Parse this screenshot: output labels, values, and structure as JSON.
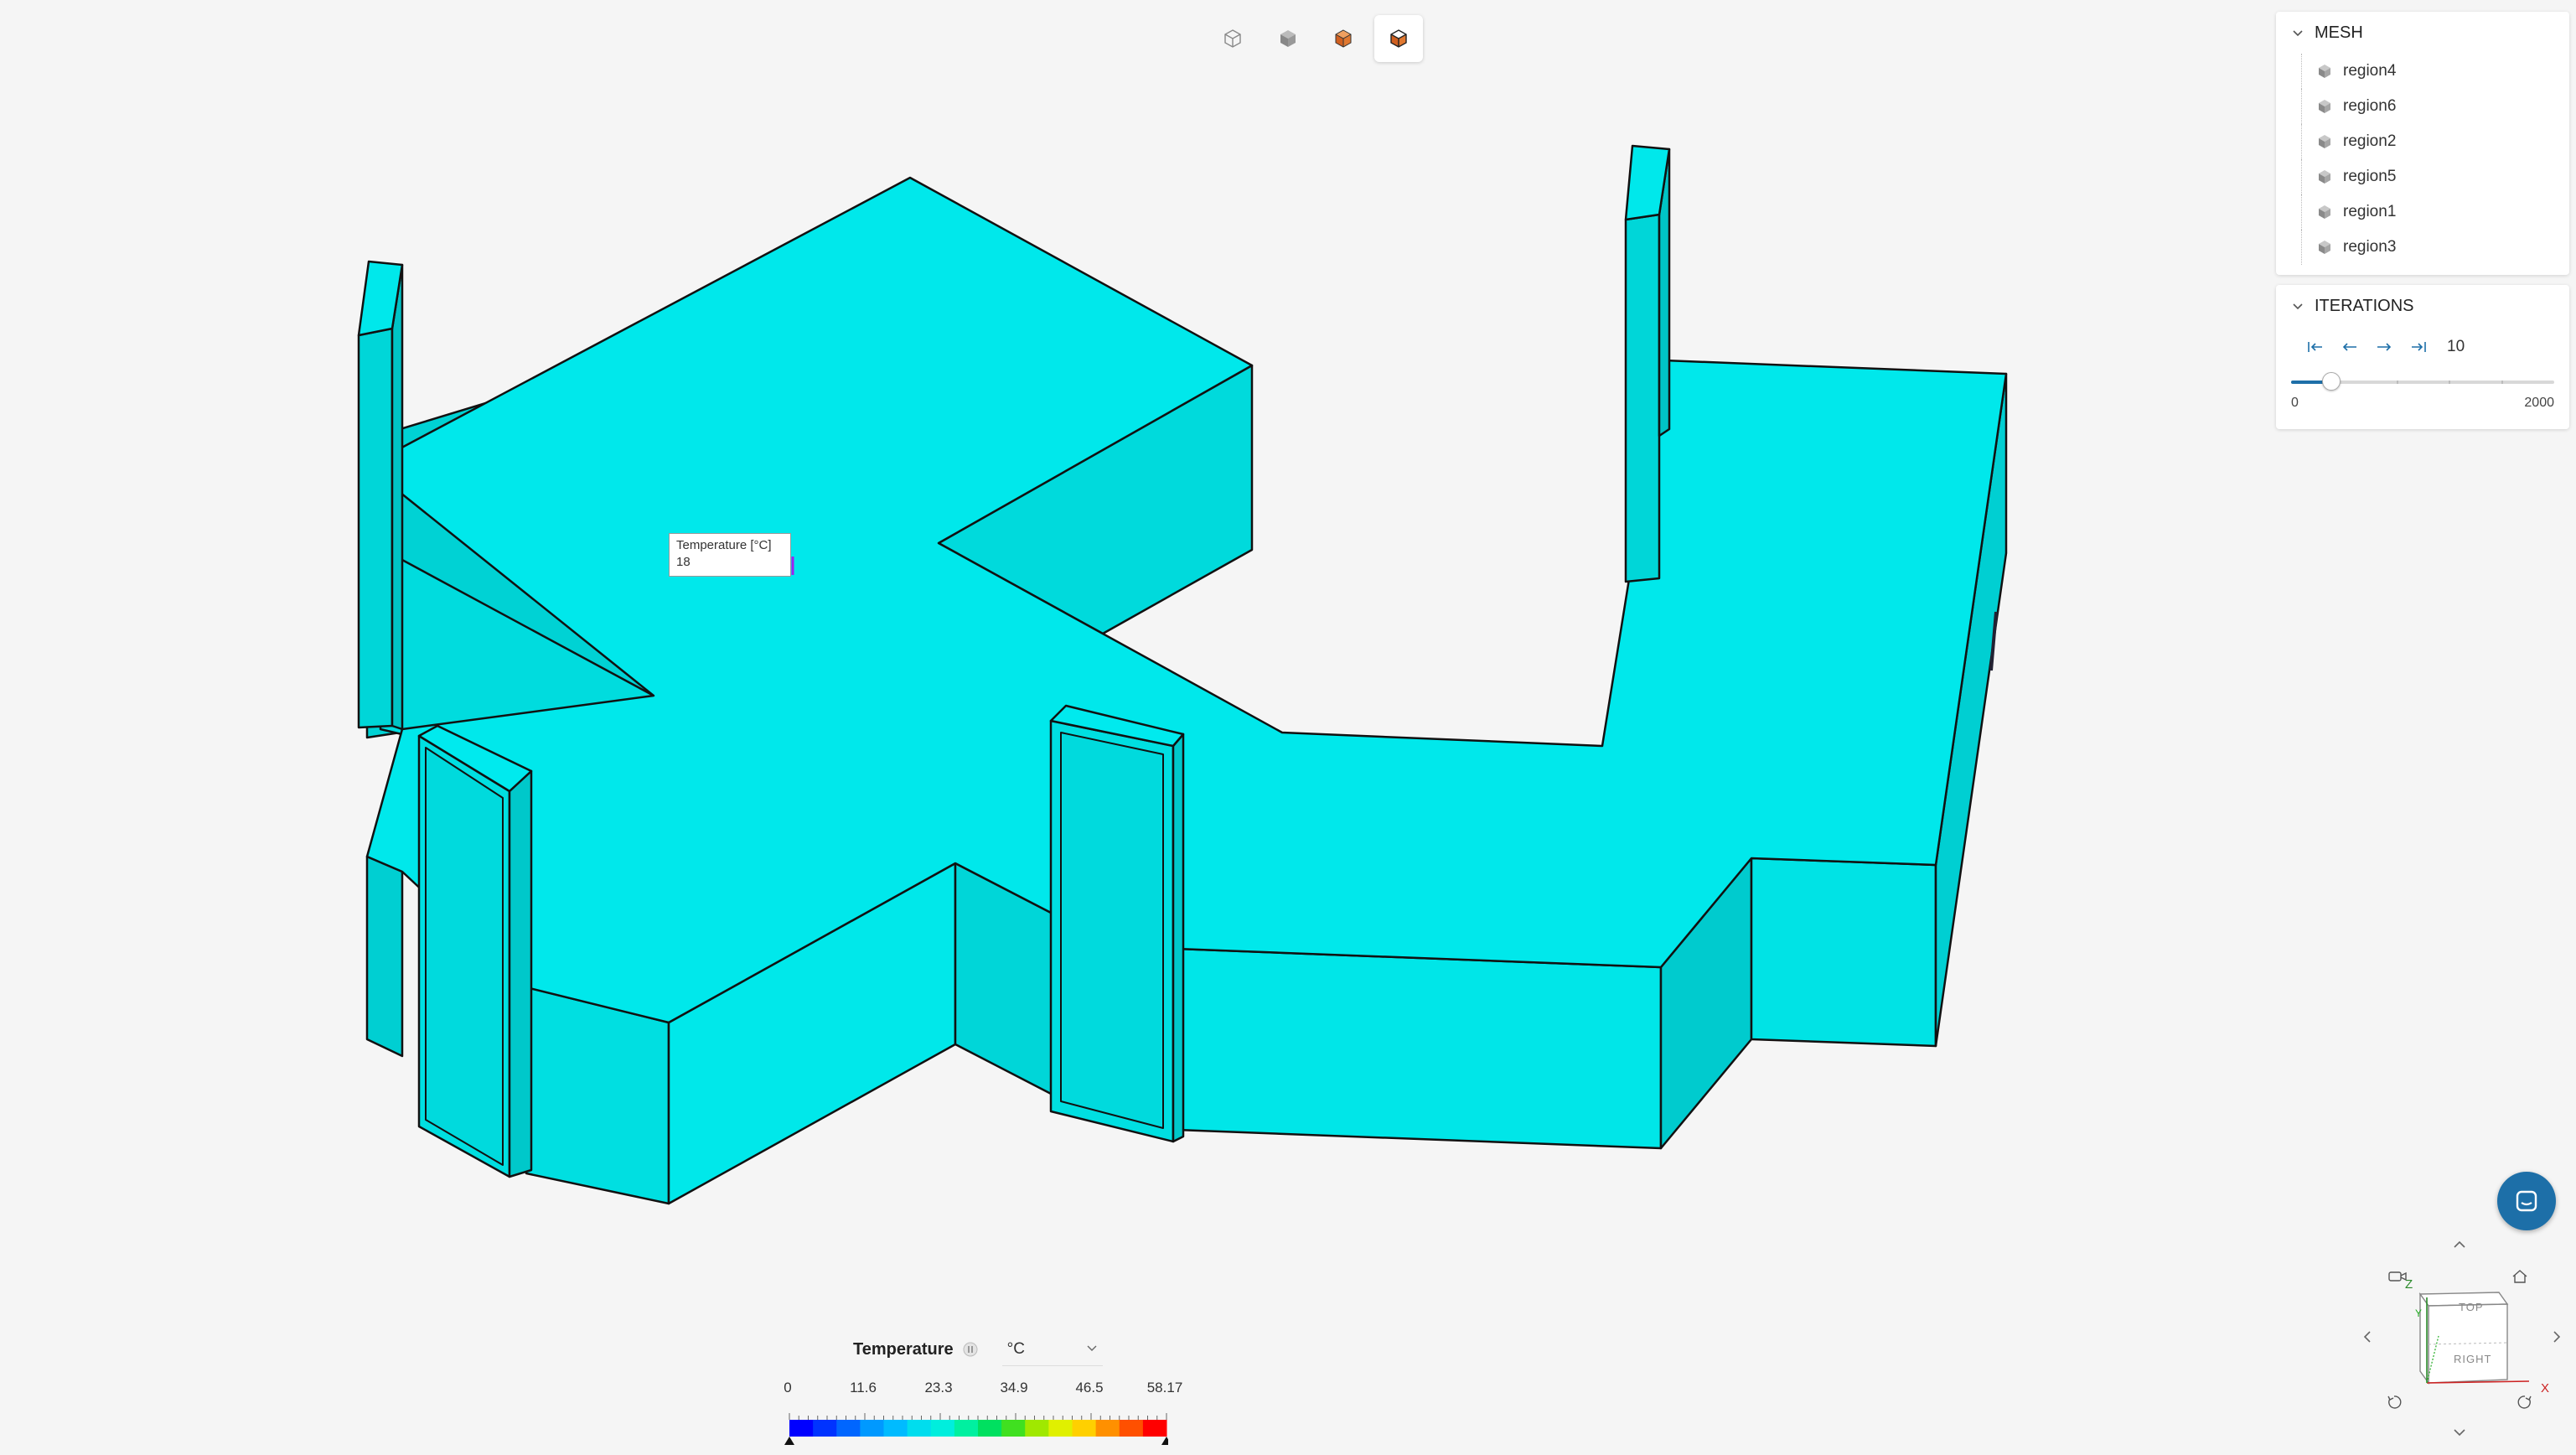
{
  "toolbar": {
    "buttons": [
      {
        "name": "wireframe-view-icon",
        "active": false
      },
      {
        "name": "solid-view-icon",
        "active": false
      },
      {
        "name": "solid-edges-view-icon",
        "active": false
      },
      {
        "name": "result-edges-view-icon",
        "active": true
      }
    ]
  },
  "mesh_panel": {
    "title": "MESH",
    "items": [
      "region4",
      "region6",
      "region2",
      "region5",
      "region1",
      "region3"
    ]
  },
  "iterations_panel": {
    "title": "ITERATIONS",
    "current": "10",
    "min_label": "0",
    "max_label": "2000",
    "progress": 0.15
  },
  "tooltip": {
    "label": "Temperature [°C]",
    "value": "18"
  },
  "legend": {
    "title": "Temperature",
    "unit": "°C",
    "ticks": [
      "0",
      "11.6",
      "23.3",
      "34.9",
      "46.5",
      "58.17"
    ],
    "colors": [
      "#0000ff",
      "#0033ff",
      "#0066ff",
      "#0099ff",
      "#00bbff",
      "#00ddee",
      "#00eedd",
      "#00f0a0",
      "#00e060",
      "#40e020",
      "#a0e800",
      "#e0f000",
      "#ffd000",
      "#ff9000",
      "#ff5000",
      "#ff0000"
    ]
  },
  "navcube": {
    "top_label": "TOP",
    "right_label": "RIGHT",
    "x_axis": "X",
    "y_axis": "Y",
    "z_axis": "Z"
  },
  "colors": {
    "surface": "#00e5e8",
    "accent": "#1d6fa8",
    "background": "#f5f5f5"
  }
}
